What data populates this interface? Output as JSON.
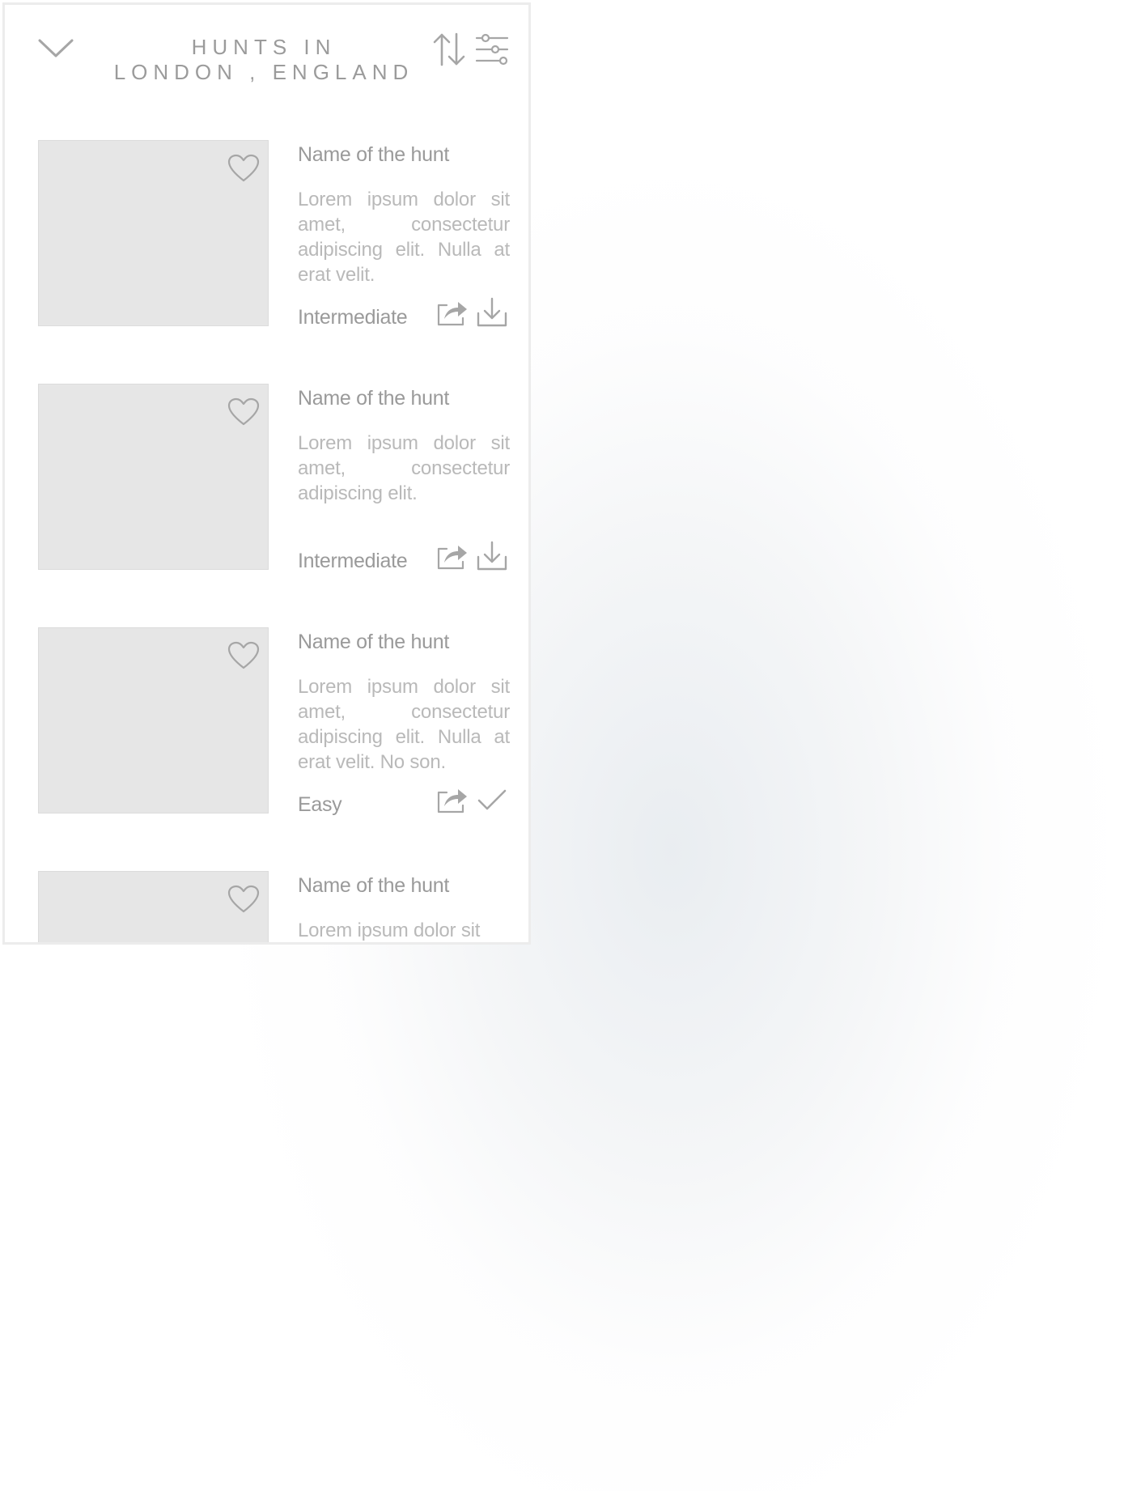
{
  "header": {
    "title_line1": "HUNTS IN",
    "title_line2": "LONDON , ENGLAND",
    "icons": [
      "chevron-down-icon",
      "sort-icon",
      "filter-sliders-icon"
    ]
  },
  "hunts": [
    {
      "name": "Name of the hunt",
      "description": "Lorem ipsum dolor sit amet, consectetur adipiscing elit. Nulla at erat velit.",
      "level": "Intermediate",
      "status_icon": "download-icon"
    },
    {
      "name": "Name of the hunt",
      "description": "Lorem ipsum dolor sit amet, consectetur adipiscing elit.",
      "level": "Intermediate",
      "status_icon": "download-icon"
    },
    {
      "name": "Name of the hunt",
      "description": "Lorem ipsum dolor sit amet, consectetur adipiscing elit. Nulla at erat velit. No son.",
      "level": "Easy",
      "status_icon": "checkmark-icon"
    },
    {
      "name": "Name of the hunt",
      "description": "Lorem ipsum dolor sit",
      "level": "",
      "status_icon": ""
    }
  ],
  "colors": {
    "icon": "#a6a6a6",
    "placeholder": "#e6e6e6",
    "text": "#9a9a9a",
    "muted_text": "#b9b9b9"
  }
}
